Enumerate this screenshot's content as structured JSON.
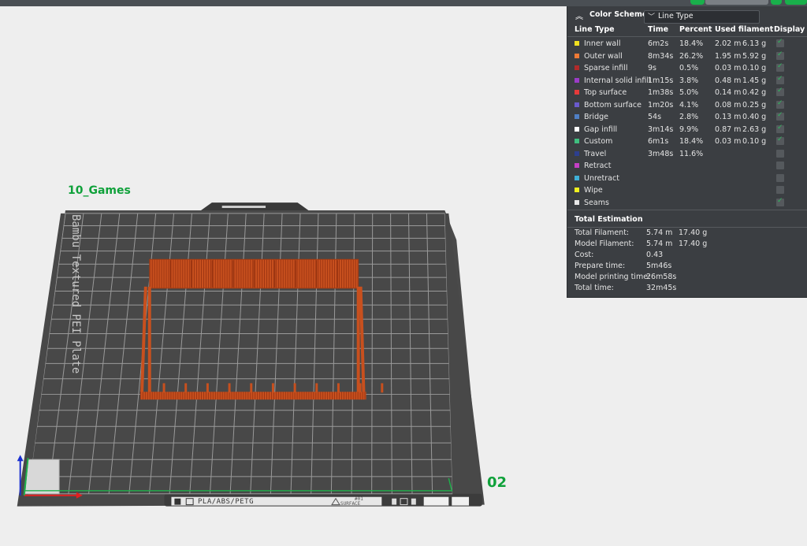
{
  "plate": {
    "name": "10_Games",
    "number": "02",
    "brand_text": "Bambu Textured PEI Plate",
    "filament_text": "PLA/ABS/PETG",
    "surface_text": "     #01\nSURFACE"
  },
  "legend": {
    "title": "Color Scheme",
    "scheme_value": "Line Type",
    "columns": {
      "line_type": "Line Type",
      "time": "Time",
      "percent": "Percent",
      "used_filament": "Used filament",
      "display": "Display"
    },
    "rows": [
      {
        "label": "Inner wall",
        "color": "#f0e020",
        "time": "6m2s",
        "percent": "18.4%",
        "length": "2.02 m",
        "weight": "6.13 g",
        "display": true
      },
      {
        "label": "Outer wall",
        "color": "#ef7a36",
        "time": "8m34s",
        "percent": "26.2%",
        "length": "1.95 m",
        "weight": "5.92 g",
        "display": true
      },
      {
        "label": "Sparse infill",
        "color": "#b22a2a",
        "time": "9s",
        "percent": "0.5%",
        "length": "0.03 m",
        "weight": "0.10 g",
        "display": true
      },
      {
        "label": "Internal solid infill",
        "color": "#9b3cc7",
        "time": "1m15s",
        "percent": "3.8%",
        "length": "0.48 m",
        "weight": "1.45 g",
        "display": true
      },
      {
        "label": "Top surface",
        "color": "#e63a3a",
        "time": "1m38s",
        "percent": "5.0%",
        "length": "0.14 m",
        "weight": "0.42 g",
        "display": true
      },
      {
        "label": "Bottom surface",
        "color": "#6a5acd",
        "time": "1m20s",
        "percent": "4.1%",
        "length": "0.08 m",
        "weight": "0.25 g",
        "display": true
      },
      {
        "label": "Bridge",
        "color": "#4f7fc4",
        "time": "54s",
        "percent": "2.8%",
        "length": "0.13 m",
        "weight": "0.40 g",
        "display": true
      },
      {
        "label": "Gap infill",
        "color": "#ffffff",
        "time": "3m14s",
        "percent": "9.9%",
        "length": "0.87 m",
        "weight": "2.63 g",
        "display": true
      },
      {
        "label": "Custom",
        "color": "#3fbf7f",
        "time": "6m1s",
        "percent": "18.4%",
        "length": "0.03 m",
        "weight": "0.10 g",
        "display": true
      },
      {
        "label": "Travel",
        "color": "#2d3f8f",
        "time": "3m48s",
        "percent": "11.6%",
        "length": "",
        "weight": "",
        "display": false
      },
      {
        "label": "Retract",
        "color": "#c53fc5",
        "time": "",
        "percent": "",
        "length": "",
        "weight": "",
        "display": false
      },
      {
        "label": "Unretract",
        "color": "#3fb0d8",
        "time": "",
        "percent": "",
        "length": "",
        "weight": "",
        "display": false
      },
      {
        "label": "Wipe",
        "color": "#f0f020",
        "time": "",
        "percent": "",
        "length": "",
        "weight": "",
        "display": false
      },
      {
        "label": "Seams",
        "color": "#e8e8e8",
        "time": "",
        "percent": "",
        "length": "",
        "weight": "",
        "display": true
      }
    ],
    "total": {
      "title": "Total Estimation",
      "rows": [
        {
          "label": "Total Filament:",
          "value": "5.74 m",
          "value2": "17.40 g"
        },
        {
          "label": "Model Filament:",
          "value": "5.74 m",
          "value2": "17.40 g"
        },
        {
          "label": "Cost:",
          "value": "0.43",
          "value2": ""
        },
        {
          "label": "Prepare time:",
          "value": "5m46s",
          "value2": ""
        },
        {
          "label": "Model printing time:",
          "value": "26m58s",
          "value2": ""
        },
        {
          "label": "Total time:",
          "value": "32m45s",
          "value2": ""
        }
      ]
    }
  },
  "colors": {
    "accent": "#0fa13a",
    "model": "#c8501e",
    "plate": "#4a4a4a"
  }
}
